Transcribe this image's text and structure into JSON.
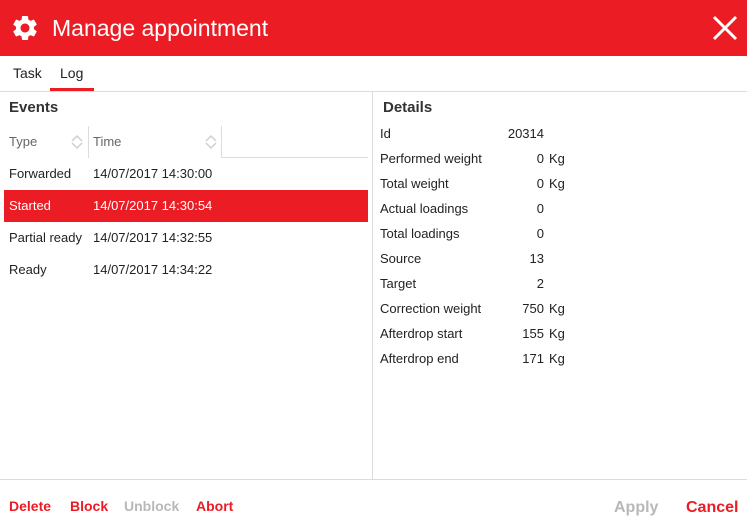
{
  "window": {
    "title": "Manage appointment",
    "icon": "gear-icon",
    "close_icon": "close-icon",
    "accent_color": "#ec1c24"
  },
  "tabs": [
    {
      "label": "Task",
      "active": false
    },
    {
      "label": "Log",
      "active": true
    }
  ],
  "events": {
    "title": "Events",
    "columns": [
      "Type",
      "Time"
    ],
    "rows": [
      {
        "type": "Forwarded",
        "time": "14/07/2017 14:30:00",
        "selected": false
      },
      {
        "type": "Started",
        "time": "14/07/2017 14:30:54",
        "selected": true
      },
      {
        "type": "Partial ready",
        "time": "14/07/2017 14:32:55",
        "selected": false
      },
      {
        "type": "Ready",
        "time": "14/07/2017 14:34:22",
        "selected": false
      }
    ]
  },
  "details": {
    "title": "Details",
    "rows": [
      {
        "label": "Id",
        "value": "20314",
        "unit": ""
      },
      {
        "label": "Performed weight",
        "value": "0",
        "unit": "Kg"
      },
      {
        "label": "Total weight",
        "value": "0",
        "unit": "Kg"
      },
      {
        "label": "Actual loadings",
        "value": "0",
        "unit": ""
      },
      {
        "label": "Total loadings",
        "value": "0",
        "unit": ""
      },
      {
        "label": "Source",
        "value": "13",
        "unit": ""
      },
      {
        "label": "Target",
        "value": "2",
        "unit": ""
      },
      {
        "label": "Correction weight",
        "value": "750",
        "unit": "Kg"
      },
      {
        "label": "Afterdrop start",
        "value": "155",
        "unit": "Kg"
      },
      {
        "label": "Afterdrop end",
        "value": "171",
        "unit": "Kg"
      }
    ]
  },
  "footer": {
    "delete_label": "Delete",
    "block_label": "Block",
    "unblock_label": "Unblock",
    "abort_label": "Abort",
    "apply_label": "Apply",
    "cancel_label": "Cancel",
    "unblock_enabled": false,
    "apply_enabled": false
  }
}
